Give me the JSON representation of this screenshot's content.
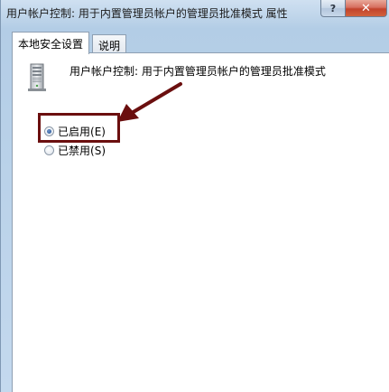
{
  "window": {
    "title": "用户帐户控制: 用于内置管理员帐户的管理员批准模式 属性",
    "help_glyph": "?",
    "close_glyph": "✕"
  },
  "tabs": [
    {
      "label": "本地安全设置",
      "active": true
    },
    {
      "label": "说明",
      "active": false
    }
  ],
  "policy": {
    "icon": "server-tower-icon",
    "name": "用户帐户控制: 用于内置管理员帐户的管理员批准模式"
  },
  "options": [
    {
      "label": "已启用",
      "accel": "(E)",
      "checked": true
    },
    {
      "label": "已禁用",
      "accel": "(S)",
      "checked": false
    }
  ],
  "annotation": {
    "color": "#6b0f0f"
  }
}
